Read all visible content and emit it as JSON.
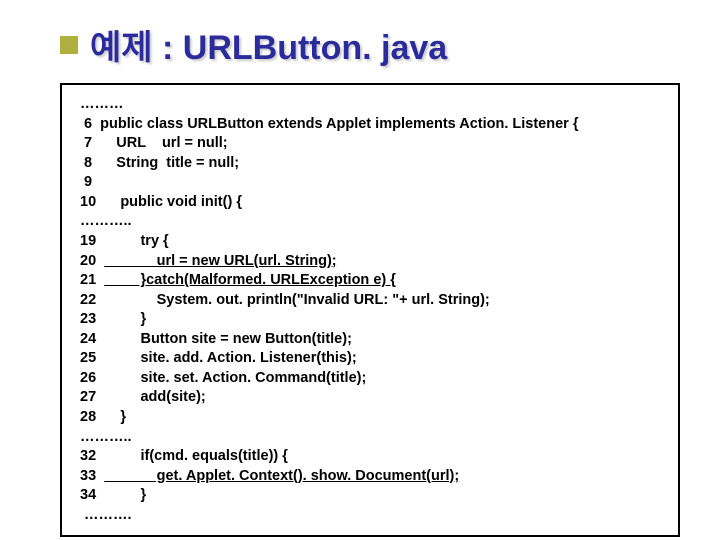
{
  "title": "예제 : URLButton. java",
  "code": {
    "lines": [
      {
        "n": "",
        "text": " ………"
      },
      {
        "n": "  6",
        "text": "public class URLButton extends Applet implements Action. Listener {"
      },
      {
        "n": "  7",
        "text": "    URL    url = null;"
      },
      {
        "n": "  8",
        "text": "    String  title = null;"
      },
      {
        "n": "  9",
        "text": ""
      },
      {
        "n": " 10",
        "text": "    public void init() {"
      },
      {
        "n": "",
        "text": " ……….."
      },
      {
        "n": " 19",
        "text": "         try {"
      },
      {
        "n": " 20",
        "text": "             url = new URL(url. String);",
        "underline": true
      },
      {
        "n": " 21",
        "text": "         }catch(Malformed. URLException e) {",
        "underline": true
      },
      {
        "n": " 22",
        "text": "             System. out. println(\"Invalid URL: \"+ url. String);"
      },
      {
        "n": " 23",
        "text": "         }"
      },
      {
        "n": " 24",
        "text": "         Button site = new Button(title);"
      },
      {
        "n": " 25",
        "text": "         site. add. Action. Listener(this);"
      },
      {
        "n": " 26",
        "text": "         site. set. Action. Command(title);"
      },
      {
        "n": " 27",
        "text": "         add(site);"
      },
      {
        "n": " 28",
        "text": "    }"
      },
      {
        "n": "",
        "text": " ……….."
      },
      {
        "n": " 32",
        "text": "         if(cmd. equals(title)) {"
      },
      {
        "n": " 33",
        "text": "             get. Applet. Context(). show. Document(url);",
        "underline": true
      },
      {
        "n": " 34",
        "text": "         }"
      },
      {
        "n": "",
        "text": "  ………."
      }
    ]
  }
}
